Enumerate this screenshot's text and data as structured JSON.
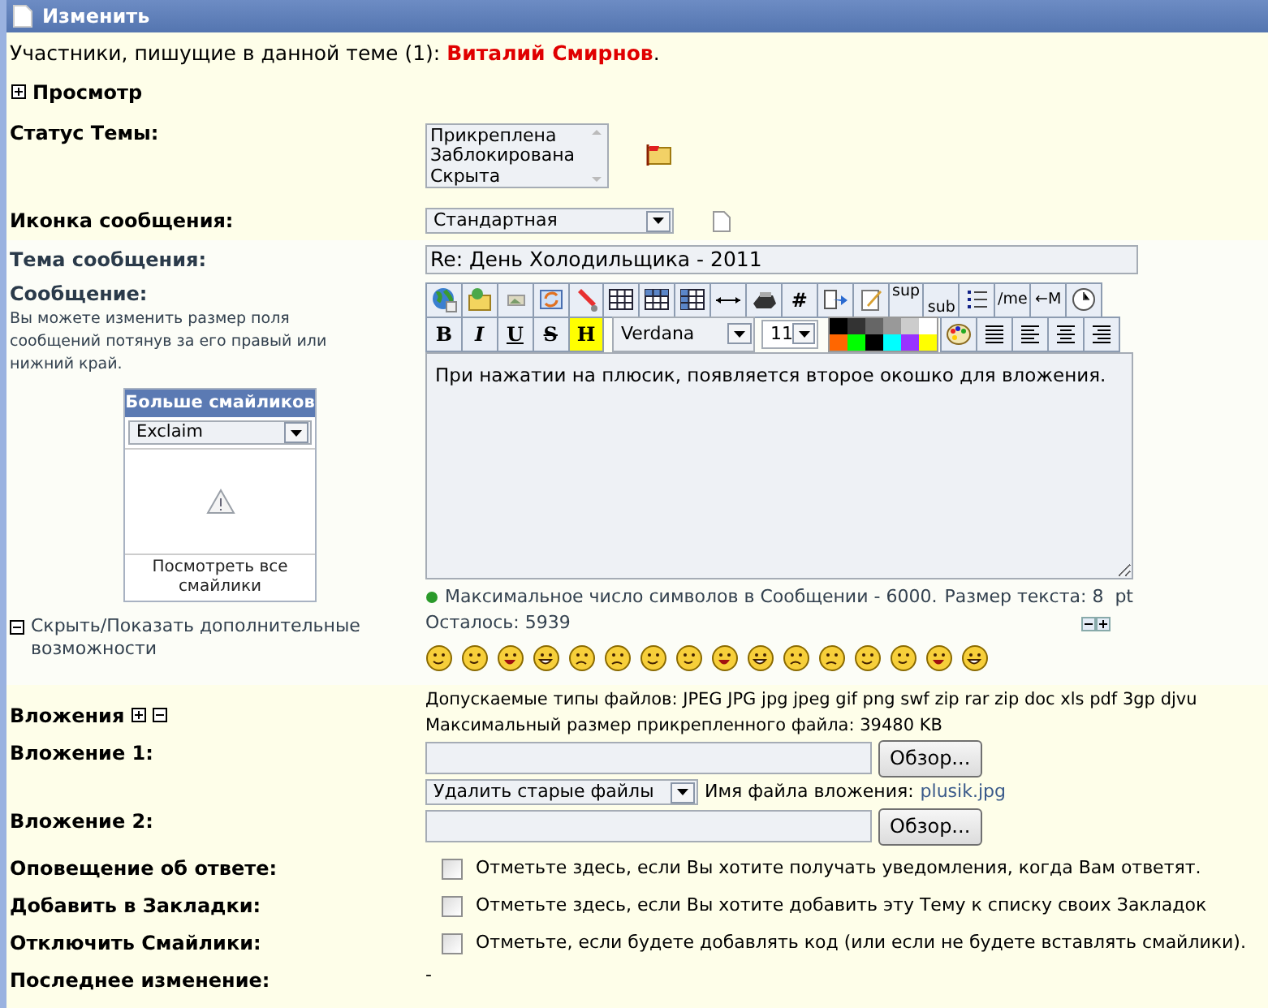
{
  "header": {
    "title": "Изменить"
  },
  "participants": {
    "text": "Участники, пишущие в данной теме (1):",
    "name": "Виталий Смирнов",
    "end": "."
  },
  "preview": {
    "label": "Просмотр",
    "expanded": false
  },
  "topic_status": {
    "label": "Статус Темы:",
    "options": [
      "Прикреплена",
      "Заблокирована",
      "Скрыта"
    ]
  },
  "message_icon": {
    "label": "Иконка сообщения:",
    "value": "Стандартная"
  },
  "subject": {
    "label": "Тема сообщения:",
    "value": "Re: День Холодильщика - 2011"
  },
  "message": {
    "label": "Сообщение:",
    "hint": "Вы можете изменить размер поля сообщений потянув за его правый или нижний край.",
    "toolbar_row_1": [
      {
        "kind": "icon"
      },
      {
        "kind": "icon"
      },
      {
        "kind": "icon"
      },
      {
        "kind": "icon"
      },
      {
        "kind": "icon"
      },
      {
        "kind": "icon"
      },
      {
        "kind": "icon"
      },
      {
        "kind": "icon"
      },
      {
        "kind": "icon"
      },
      {
        "kind": "icon"
      },
      {
        "kind": "text",
        "label": "#"
      },
      {
        "kind": "icon"
      },
      {
        "kind": "icon"
      },
      {
        "kind": "sup",
        "label": "sup"
      },
      {
        "kind": "sub",
        "label": "sub"
      },
      {
        "kind": "icon"
      },
      {
        "kind": "text",
        "label": "/me"
      },
      {
        "kind": "text",
        "label": "←M"
      },
      {
        "kind": "icon"
      }
    ],
    "format_buttons": [
      {
        "kind": "bold",
        "label": "B"
      },
      {
        "kind": "italic",
        "label": "I"
      },
      {
        "kind": "underline",
        "label": "U"
      },
      {
        "kind": "strike",
        "label": "S"
      },
      {
        "kind": "highlight",
        "label": "H"
      }
    ],
    "font": "Verdana",
    "size": "11",
    "colors": [
      {
        "color": "#000000"
      },
      {
        "color": "#333333"
      },
      {
        "color": "#666666"
      },
      {
        "color": "#999999"
      },
      {
        "color": "#cccccc"
      },
      {
        "color": "#ffffff"
      },
      {
        "color": "#ff6600"
      },
      {
        "color": "#00ff00"
      },
      {
        "color": "#000000"
      },
      {
        "color": "#00ffff"
      },
      {
        "color": "#9933ff"
      },
      {
        "color": "#ffff00"
      }
    ],
    "text": "При нажатии на плюсик, появляется второе окошко для вложения.",
    "max_chars": "Максимальное число символов в Сообщении - 6000.",
    "text_size_label": "Размер текста:",
    "text_size": "8",
    "text_size_unit": "pt",
    "remaining_label": "Осталось:",
    "remaining": "5939"
  },
  "more_smilies": {
    "title": "Больше смайликов",
    "category": "Exclaim",
    "link": "Посмотреть все смайлики"
  },
  "extra_toggle": {
    "label": "Скрыть/Показать дополнительные возможности",
    "expanded": true
  },
  "attachments": {
    "label": "Вложения",
    "types": "Допускаемые типы файлов: JPEG JPG jpg jpeg gif png swf zip rar zip doc xls pdf 3gp djvu",
    "max_size": "Максимальный размер прикрепленного файла: 39480 KB"
  },
  "attachment_fields": [
    {
      "label": "Вложение 1:",
      "button": "Обзор...",
      "delete_option": "Удалить старые файлы",
      "filename_label": "Имя файла вложения:",
      "filename": "plusik.jpg"
    },
    {
      "label": "Вложение 2:",
      "button": "Обзор..."
    }
  ],
  "options": [
    {
      "label": "Оповещение об ответе:",
      "text": "Отметьте здесь, если Вы хотите получать уведомления, когда Вам ответят.",
      "checked": false
    },
    {
      "label": "Добавить в Закладки:",
      "text": "Отметьте здесь, если Вы хотите добавить эту Тему к списку своих Закладок",
      "checked": false
    },
    {
      "label": "Отключить Смайлики:",
      "text": "Отметьте, если будете добавлять код (или если не будете вставлять смайлики).",
      "checked": false
    }
  ],
  "last_edit": {
    "label": "Последнее изменение:",
    "value": "-"
  }
}
